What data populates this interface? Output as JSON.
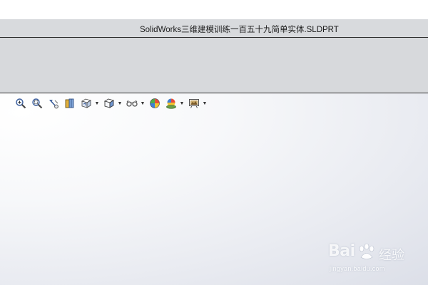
{
  "window": {
    "title": "SolidWorks三维建模训练一百五十九简单实体.SLDPRT"
  },
  "heads_up_toolbar": {
    "items": [
      {
        "icon": "zoom-to-fit-icon",
        "has_dropdown": false
      },
      {
        "icon": "zoom-to-area-icon",
        "has_dropdown": false
      },
      {
        "icon": "previous-view-icon",
        "has_dropdown": false
      },
      {
        "icon": "section-view-icon",
        "has_dropdown": false
      },
      {
        "icon": "view-orientation-icon",
        "has_dropdown": true
      },
      {
        "icon": "display-style-icon",
        "has_dropdown": true
      },
      {
        "icon": "hide-show-items-icon",
        "has_dropdown": true
      },
      {
        "icon": "edit-appearance-icon",
        "has_dropdown": false
      },
      {
        "icon": "apply-scene-icon",
        "has_dropdown": true
      },
      {
        "icon": "view-settings-icon",
        "has_dropdown": true
      }
    ],
    "dropdown_glyph": "▼"
  },
  "watermark": {
    "brand": "Bai",
    "product": "经验",
    "url": "jingyan.baidu.com"
  },
  "colors": {
    "title_bar": "#d8dadd",
    "ribbon": "#d7d9dc",
    "viewport_light": "#ffffff",
    "viewport_dark": "#dcdfe8"
  }
}
